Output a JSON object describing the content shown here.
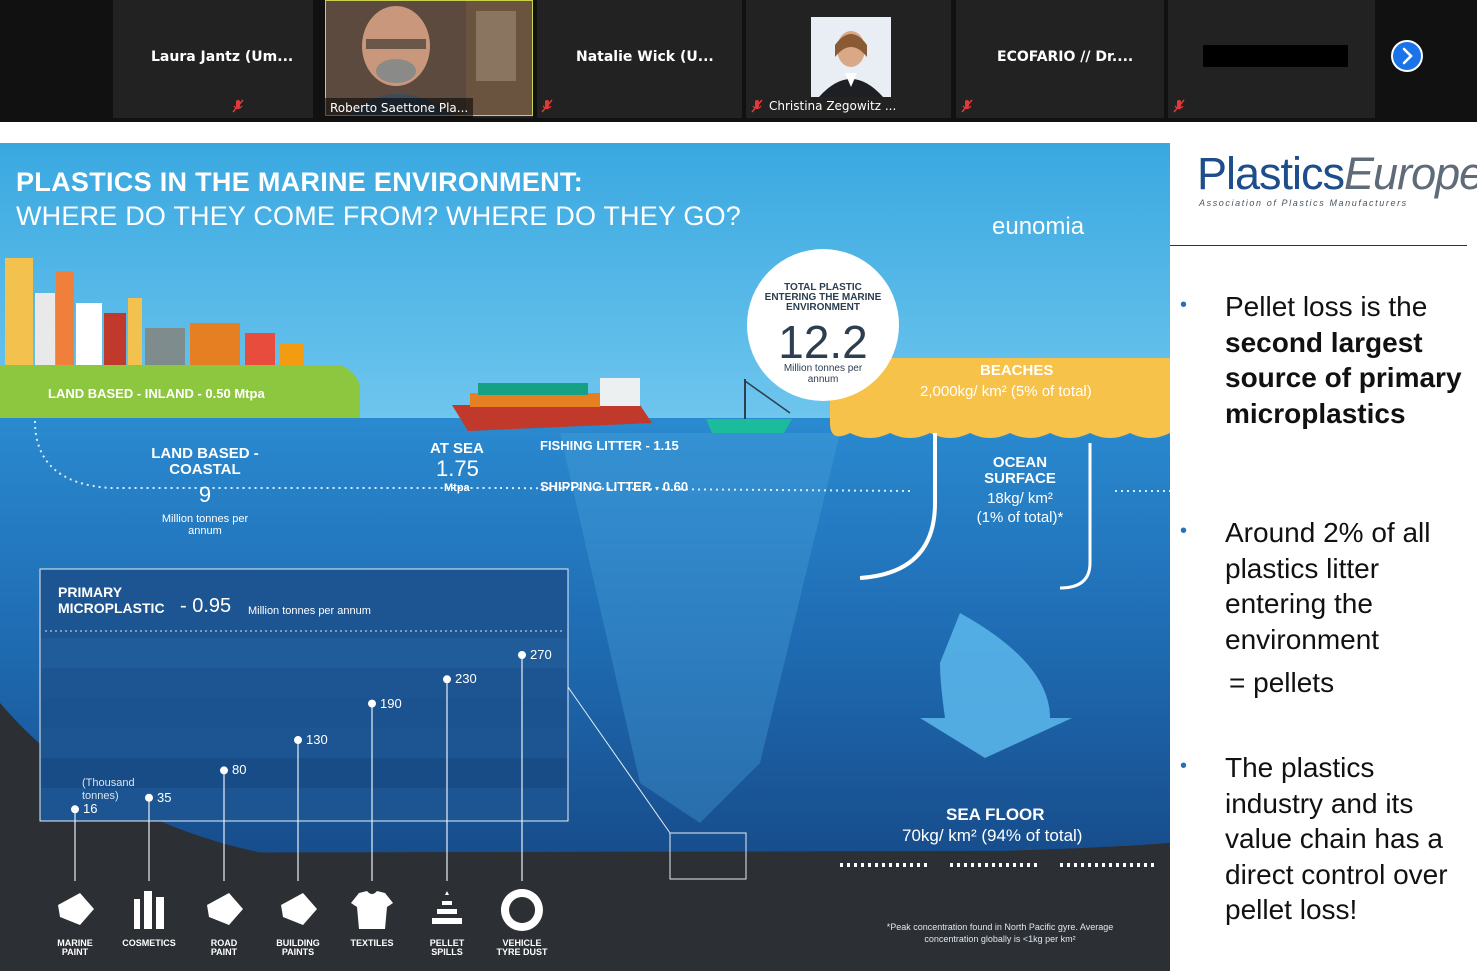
{
  "participants": [
    {
      "name": "Laura Jantz (Um...",
      "video": false,
      "muted": true
    },
    {
      "name": "Roberto Saettone Pla...",
      "video": true,
      "muted": false
    },
    {
      "name": "Natalie Wick (U...",
      "video": false,
      "muted": true
    },
    {
      "name": "Christina Zegowitz ...",
      "video": true,
      "muted": true
    },
    {
      "name": "ECOFARIO // Dr....",
      "video": false,
      "muted": true
    },
    {
      "name": "",
      "video": false,
      "muted": true,
      "redacted": true
    }
  ],
  "icons": {
    "next": "chevron-right-icon",
    "mute": "mic-off-icon"
  },
  "infographic": {
    "title_line1": "PLASTICS IN THE MARINE ENVIRONMENT:",
    "title_line2": "WHERE DO THEY COME FROM? WHERE DO THEY GO?",
    "brand": "eunomia",
    "total": {
      "label": "TOTAL PLASTIC ENTERING THE MARINE ENVIRONMENT",
      "value": "12.2",
      "unit": "Million tonnes per annum"
    },
    "land_inland": "LAND BASED - INLAND - 0.50  Mtpa",
    "land_coastal": {
      "label": "LAND BASED - COASTAL",
      "value": "9",
      "unit": "Million tonnes per annum"
    },
    "at_sea": {
      "label": "AT SEA",
      "value": "1.75",
      "unit": "Mtpa"
    },
    "fishing": "FISHING LITTER - 1.15",
    "shipping": "SHIPPING LITTER - 0.60",
    "beaches": {
      "label": "BEACHES",
      "value": "2,000kg/ km² (5% of total)"
    },
    "ocean_surface": {
      "label": "OCEAN SURFACE",
      "value": "18kg/ km²",
      "pct": "(1% of total)*"
    },
    "sea_floor": {
      "label": "SEA FLOOR",
      "value": "70kg/ km² (94% of total)"
    },
    "primary": {
      "label1": "PRIMARY",
      "label2": "MICROPLASTIC",
      "value": "- 0.95",
      "unit": "Million tonnes per annum",
      "axis_note": "(Thousand tonnes)"
    },
    "footnote": "*Peak concentration found in North Pacific gyre. Average concentration globally is <1kg per km²"
  },
  "chart_data": {
    "type": "lollipop",
    "title": "PRIMARY MICROPLASTIC - 0.95 Million tonnes per annum",
    "ylabel": "(Thousand tonnes)",
    "categories": [
      "MARINE PAINT",
      "COSMETICS",
      "ROAD PAINT",
      "BUILDING PAINTS",
      "TEXTILES",
      "PELLET SPILLS",
      "VEHICLE TYRE DUST"
    ],
    "values": [
      16,
      35,
      80,
      130,
      190,
      230,
      270
    ],
    "labels": [
      "16",
      "35",
      "80",
      "130",
      "190",
      "230",
      "270"
    ],
    "ylim": [
      0,
      280
    ]
  },
  "category_lines": [
    [
      "MARINE",
      "PAINT"
    ],
    [
      "COSMETICS"
    ],
    [
      "ROAD",
      "PAINT"
    ],
    [
      "BUILDING",
      "PAINTS"
    ],
    [
      "TEXTILES"
    ],
    [
      "PELLET",
      "SPILLS"
    ],
    [
      "VEHICLE",
      "TYRE DUST"
    ]
  ],
  "sidebar": {
    "logo_a": "Plastics",
    "logo_b": "Europe",
    "logo_sub": "Association of Plastics Manufacturers",
    "bullet1_pre": "Pellet loss is the",
    "bullet1_bold": "second largest source of primary microplastics",
    "bullet2": "Around 2% of all plastics litter entering the environment",
    "bullet2_eq": "= pellets",
    "bullet3": "The plastics industry and its value chain has a direct control over pellet loss!",
    "bullet_char": "•"
  }
}
